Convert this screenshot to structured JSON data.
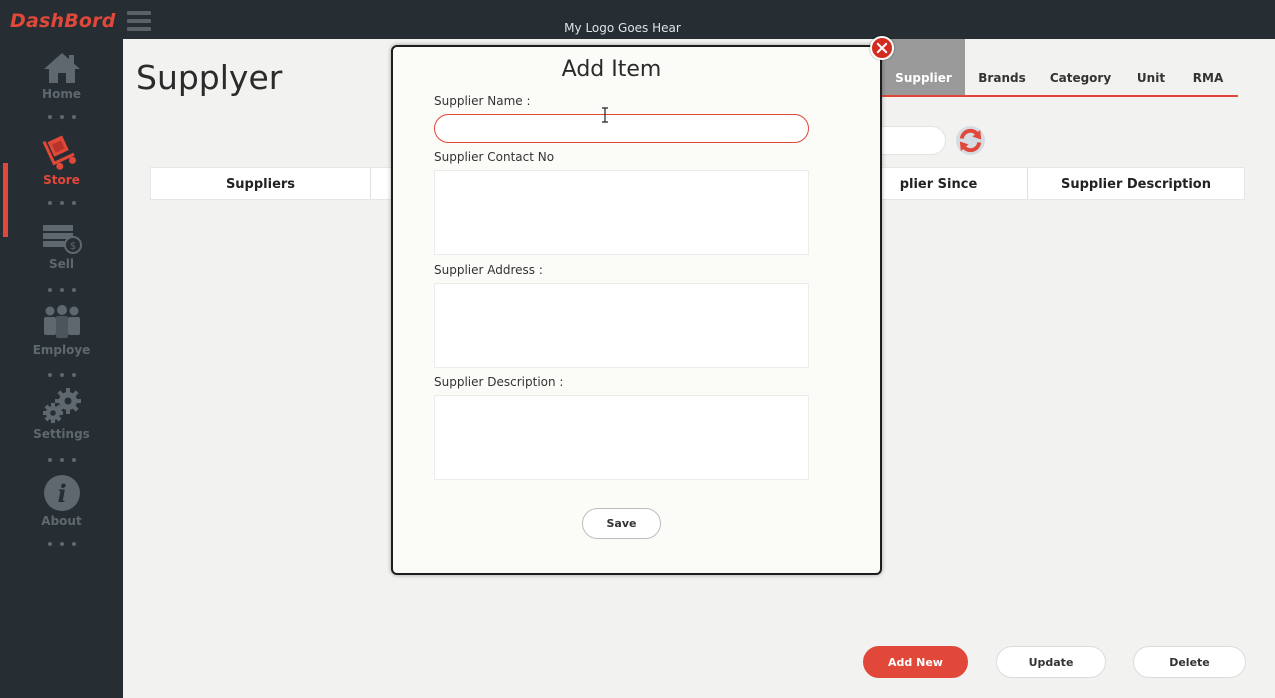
{
  "app": {
    "brand": "DashBord",
    "logo_text": "My Logo Goes Hear"
  },
  "sidebar": {
    "items": [
      {
        "label": "Home",
        "icon": "home-icon",
        "active": false
      },
      {
        "label": "Store",
        "icon": "store-trolley-icon",
        "active": true
      },
      {
        "label": "Sell",
        "icon": "sell-card-icon",
        "active": false
      },
      {
        "label": "Employe",
        "icon": "employees-icon",
        "active": false
      },
      {
        "label": "Settings",
        "icon": "gears-icon",
        "active": false
      },
      {
        "label": "About",
        "icon": "info-icon",
        "active": false
      }
    ]
  },
  "page": {
    "title": "Supplyer"
  },
  "tabs": [
    {
      "label": "Supplier",
      "active": true
    },
    {
      "label": "Brands",
      "active": false
    },
    {
      "label": "Category",
      "active": false
    },
    {
      "label": "Unit",
      "active": false
    },
    {
      "label": "RMA",
      "active": false
    }
  ],
  "table": {
    "columns": [
      "Suppliers",
      "",
      "plier Since",
      "Supplier Description"
    ]
  },
  "actions": {
    "add_new": "Add New",
    "update": "Update",
    "delete": "Delete"
  },
  "modal": {
    "title": "Add Item",
    "fields": {
      "name_label": "Supplier Name :",
      "name_value": "",
      "contact_label": "Supplier Contact No",
      "contact_value": "",
      "address_label": "Supplier Address :",
      "address_value": "",
      "description_label": "Supplier Description :",
      "description_value": ""
    },
    "save_label": "Save"
  },
  "colors": {
    "accent": "#e2483a",
    "sidebar_bg": "#262e33",
    "content_bg": "#f2f2f0",
    "tab_active_bg": "#9a9a9a",
    "close_button": "#d42b20"
  }
}
